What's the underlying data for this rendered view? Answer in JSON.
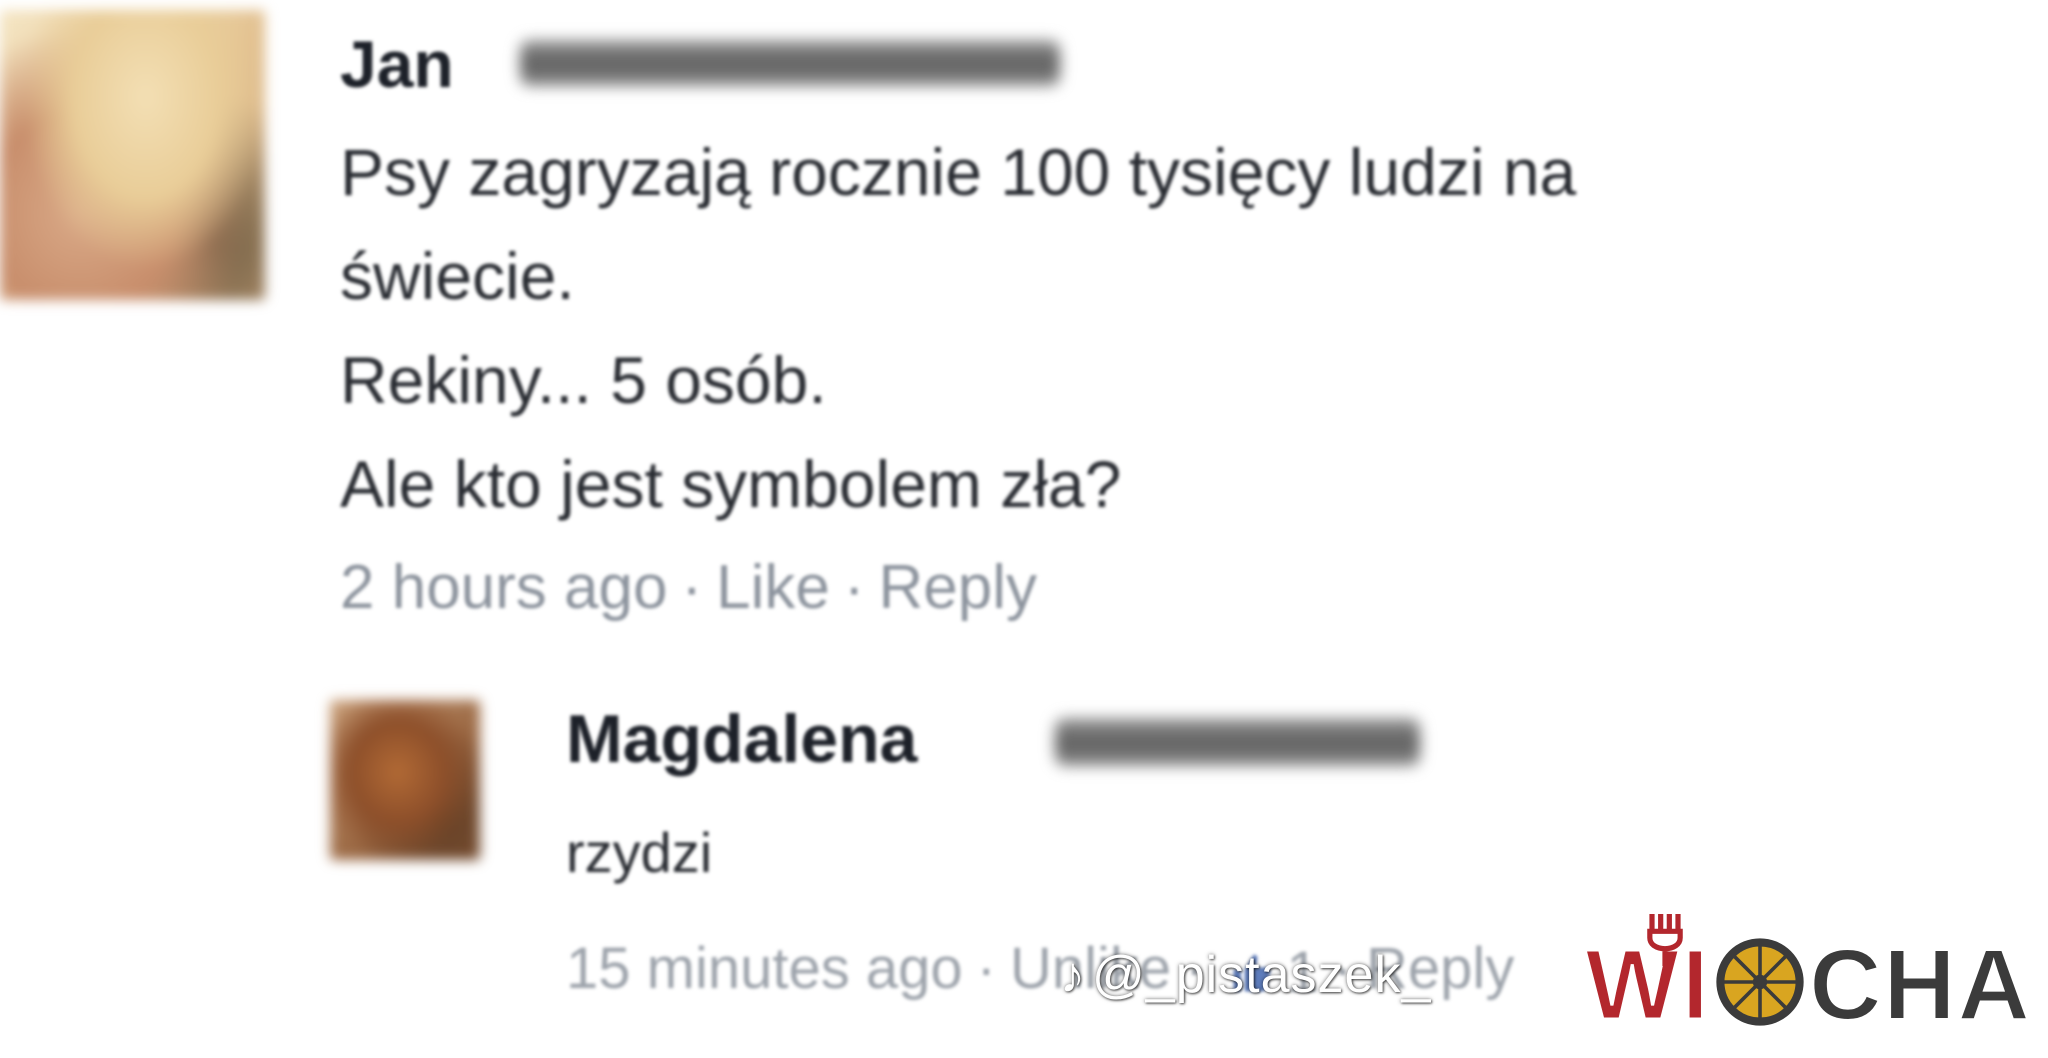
{
  "comment": {
    "author": "Jan",
    "lines": [
      "Psy zagryzają rocznie 100 tysięcy ludzi na",
      "świecie.",
      "Rekiny... 5 osób.",
      "Ale kto jest symbolem zła?"
    ],
    "timestamp": "2 hours ago",
    "separator": "·",
    "like_label": "Like",
    "reply_label": "Reply"
  },
  "reply": {
    "author": "Magdalena",
    "text": "rzydzi",
    "timestamp": "15 minutes ago",
    "separator": "·",
    "unlike_label": "Unlike",
    "like_count": "1",
    "reply_label": "Reply"
  },
  "watermark": {
    "handle": "@_pistaszek_",
    "icon": "tiktok-icon"
  },
  "brand": {
    "prefix": "W",
    "suffix": "CHA",
    "colors": {
      "red": "#b3272d",
      "dark": "#3b3b3b",
      "gold": "#d9a520"
    }
  },
  "colors": {
    "name": "#1d2129",
    "text": "#2a2d33",
    "meta": "#8d949e",
    "like_blue": "#4267b2"
  }
}
